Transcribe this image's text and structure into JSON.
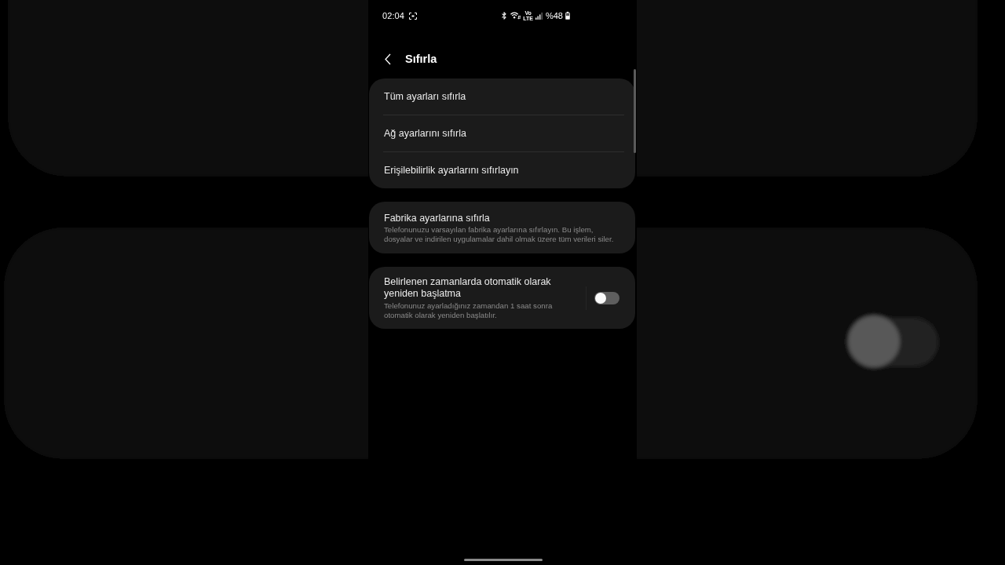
{
  "status_bar": {
    "time": "02:04",
    "network": [
      "Vo",
      "LTE"
    ],
    "battery": "%48"
  },
  "header": {
    "title": "Sıfırla"
  },
  "reset_options": [
    {
      "label": "Tüm ayarları sıfırla"
    },
    {
      "label": "Ağ ayarlarını sıfırla"
    },
    {
      "label": "Erişilebilirlik ayarlarını sıfırlayın"
    }
  ],
  "factory_reset": {
    "title": "Fabrika ayarlarına sıfırla",
    "description": "Telefonunuzu varsayılan fabrika ayarlarına sıfırlayın. Bu işlem, dosyalar ve indirilen uygulamalar dahil olmak üzere tüm verileri siler."
  },
  "auto_restart": {
    "title": "Belirlenen zamanlarda otomatik olarak yeniden başlatma",
    "description": "Telefonunuz ayarladığınız zamandan 1 saat sonra otomatik olarak yeniden başlatılır.",
    "on": false
  }
}
